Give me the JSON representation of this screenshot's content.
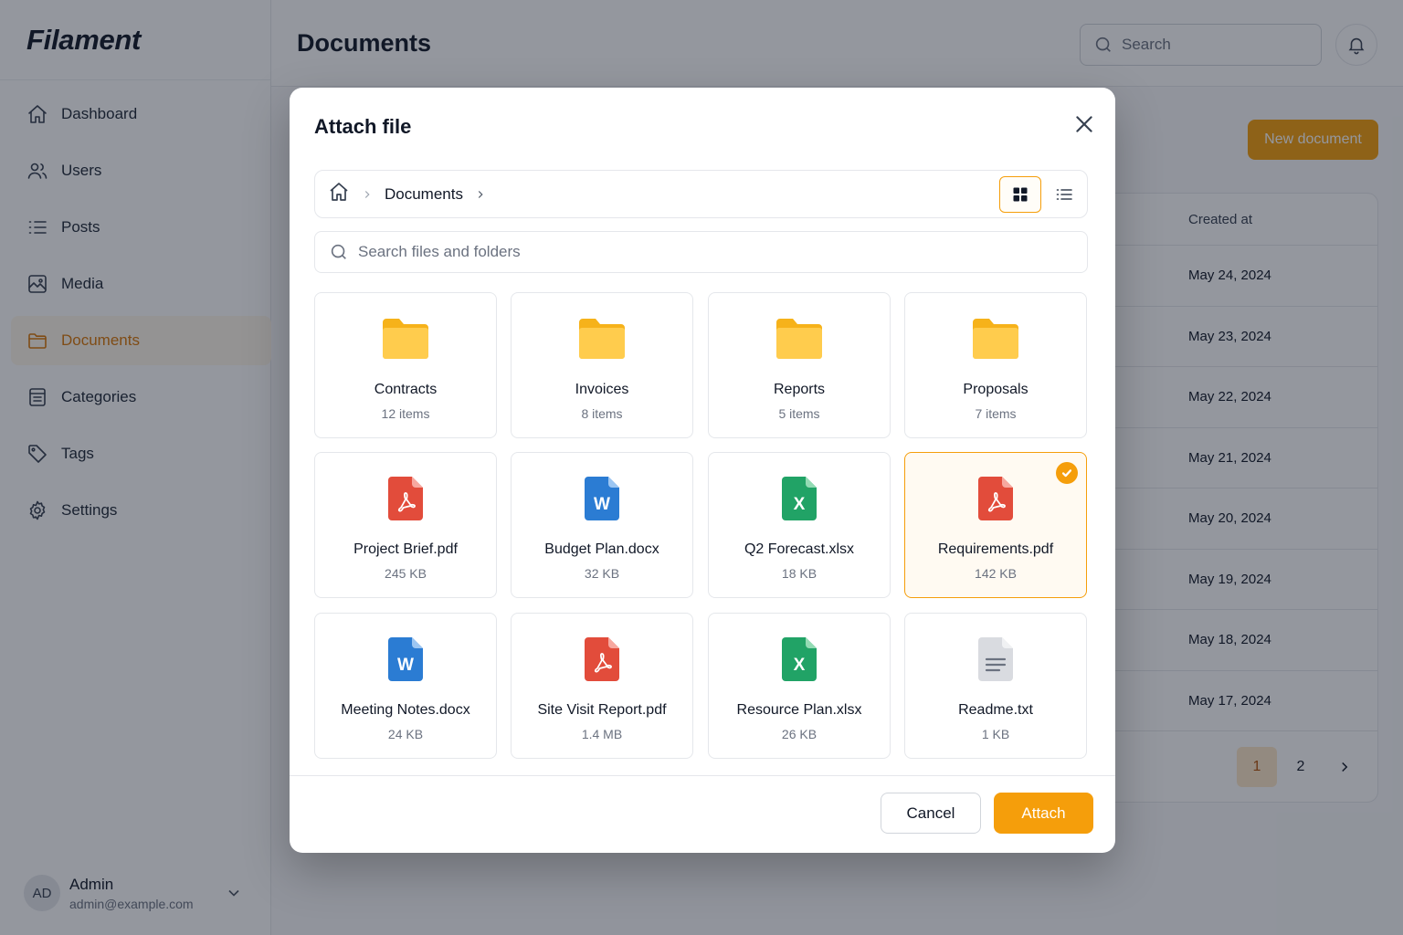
{
  "app": {
    "brand": "Filament",
    "page_title": "Documents"
  },
  "colors": {
    "accent": "#f59e0b",
    "folder": "#fbbf24",
    "pdf": "#e24c3b",
    "docx": "#2b7cd3",
    "xlsx": "#21a366",
    "txt": "#d1d5db"
  },
  "sidebar": {
    "items": [
      {
        "label": "Dashboard",
        "icon": "home-icon"
      },
      {
        "label": "Users",
        "icon": "users-icon"
      },
      {
        "label": "Posts",
        "icon": "list-icon"
      },
      {
        "label": "Media",
        "icon": "image-icon"
      },
      {
        "label": "Documents",
        "icon": "folder-icon",
        "active": true
      },
      {
        "label": "Categories",
        "icon": "categories-icon"
      },
      {
        "label": "Tags",
        "icon": "tag-icon"
      },
      {
        "label": "Settings",
        "icon": "gear-icon"
      }
    ],
    "user": {
      "initials": "AD",
      "name": "Admin",
      "email": "admin@example.com"
    }
  },
  "topbar": {
    "search_placeholder": "Search"
  },
  "header_actions": {
    "new_document": "New document"
  },
  "table": {
    "column": "Created at",
    "rows": [
      "May 24, 2024",
      "May 23, 2024",
      "May 22, 2024",
      "May 21, 2024",
      "May 20, 2024",
      "May 19, 2024",
      "May 18, 2024",
      "May 17, 2024"
    ],
    "pagination": {
      "pages": [
        "1",
        "2"
      ],
      "current": "1"
    }
  },
  "modal": {
    "title": "Attach file",
    "breadcrumb": "Documents",
    "view_mode": "grid",
    "search_placeholder": "Search files and folders",
    "items": [
      {
        "type": "folder",
        "name": "Contracts",
        "meta": "12 items"
      },
      {
        "type": "folder",
        "name": "Invoices",
        "meta": "8 items"
      },
      {
        "type": "folder",
        "name": "Reports",
        "meta": "5 items"
      },
      {
        "type": "folder",
        "name": "Proposals",
        "meta": "7 items"
      },
      {
        "type": "pdf",
        "name": "Project Brief.pdf",
        "meta": "245 KB"
      },
      {
        "type": "docx",
        "name": "Budget Plan.docx",
        "meta": "32 KB"
      },
      {
        "type": "xlsx",
        "name": "Q2 Forecast.xlsx",
        "meta": "18 KB"
      },
      {
        "type": "pdf",
        "name": "Requirements.pdf",
        "meta": "142 KB",
        "selected": true
      },
      {
        "type": "docx",
        "name": "Meeting Notes.docx",
        "meta": "24 KB"
      },
      {
        "type": "pdf",
        "name": "Site Visit Report.pdf",
        "meta": "1.4 MB"
      },
      {
        "type": "xlsx",
        "name": "Resource Plan.xlsx",
        "meta": "26 KB"
      },
      {
        "type": "txt",
        "name": "Readme.txt",
        "meta": "1 KB"
      }
    ],
    "cancel_label": "Cancel",
    "attach_label": "Attach"
  }
}
